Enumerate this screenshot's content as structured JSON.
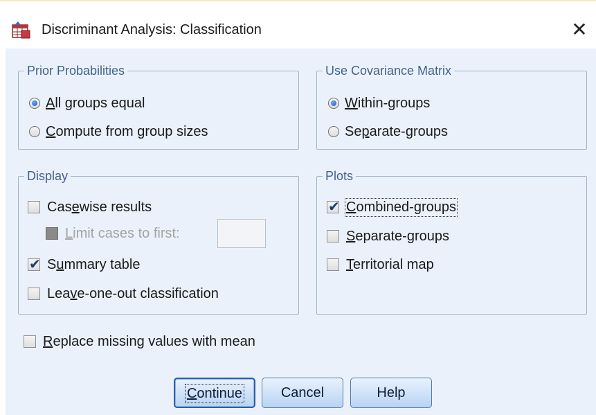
{
  "window": {
    "title": "Discriminant Analysis: Classification",
    "close_glyph": "✕"
  },
  "prior_probabilities": {
    "legend": "Prior Probabilities",
    "options": [
      {
        "label": "All groups equal",
        "mnemonic_index": 0,
        "selected": true
      },
      {
        "label": "Compute from group sizes",
        "mnemonic_index": 0,
        "selected": false
      }
    ]
  },
  "covariance_matrix": {
    "legend": "Use Covariance Matrix",
    "options": [
      {
        "label": "Within-groups",
        "mnemonic_index": 0,
        "selected": true
      },
      {
        "label": "Separate-groups",
        "mnemonic_index": 2,
        "selected": false
      }
    ]
  },
  "display": {
    "legend": "Display",
    "casewise": {
      "label": "Casewise results",
      "mnemonic_index": 3,
      "checked": false
    },
    "limit_cases": {
      "label": "Limit cases to first:",
      "mnemonic_index": 0,
      "checked": false,
      "enabled": false,
      "value": ""
    },
    "summary": {
      "label": "Summary table",
      "mnemonic_index": 1,
      "checked": true
    },
    "leave_one_out": {
      "label": "Leave-one-out classification",
      "mnemonic_index": 3,
      "checked": false
    }
  },
  "plots": {
    "legend": "Plots",
    "combined": {
      "label": "Combined-groups",
      "mnemonic_index": 0,
      "checked": true
    },
    "separate": {
      "label": "Separate-groups",
      "mnemonic_index": 0,
      "checked": false
    },
    "territorial": {
      "label": "Territorial map",
      "mnemonic_index": 0,
      "checked": false
    }
  },
  "replace_missing": {
    "label": "Replace missing values with mean",
    "mnemonic_index": 0,
    "checked": false
  },
  "buttons": {
    "continue": {
      "label": "Continue",
      "mnemonic_index": 0
    },
    "cancel": {
      "label": "Cancel"
    },
    "help": {
      "label": "Help"
    }
  },
  "icons": {
    "app": "spss-table-icon",
    "close": "close-icon",
    "check": "checkmark-icon"
  }
}
